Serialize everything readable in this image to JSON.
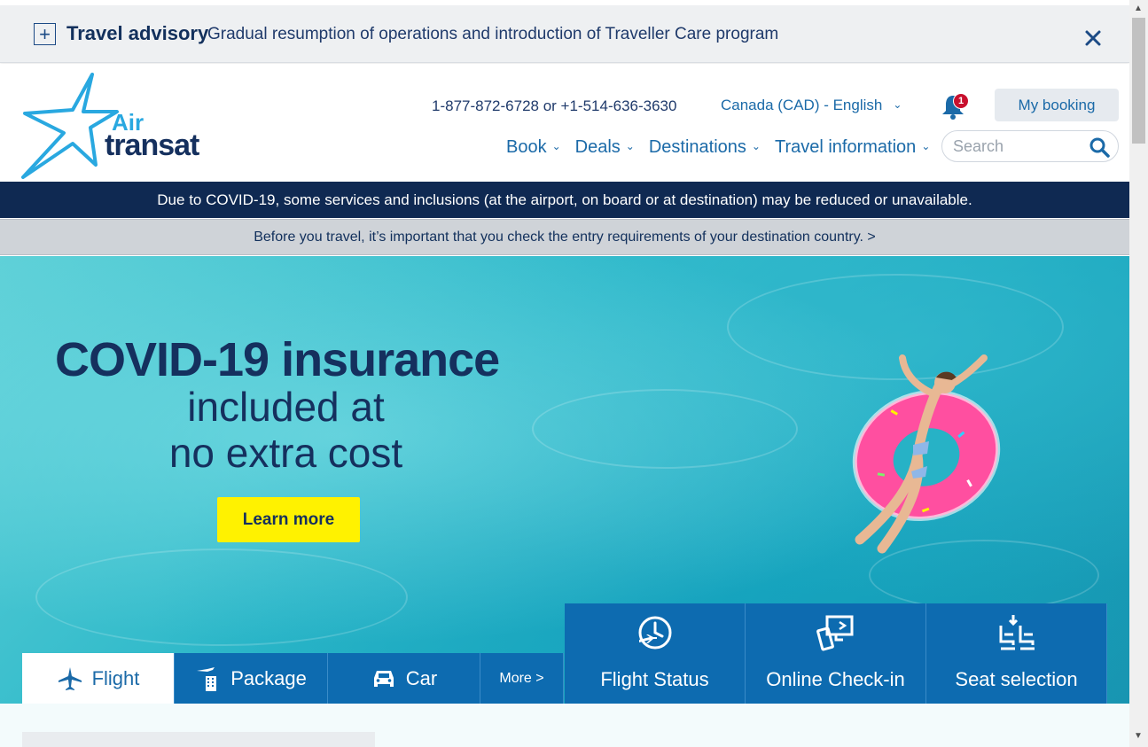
{
  "advisory": {
    "title": "Travel advisory",
    "text": "Gradual resumption of operations and introduction of Traveller Care program"
  },
  "brand": {
    "line1": "Air",
    "line2": "transat"
  },
  "header": {
    "phone": "1-877-872-6728 or +1-514-636-3630",
    "locale": "Canada (CAD) - English",
    "notifications_count": "1",
    "my_booking": "My booking"
  },
  "nav": {
    "items": [
      {
        "label": "Book"
      },
      {
        "label": "Deals"
      },
      {
        "label": "Destinations"
      },
      {
        "label": "Travel information"
      }
    ]
  },
  "search": {
    "placeholder": "Search"
  },
  "banners": {
    "covid": "Due to COVID-19, some services and inclusions (at the airport, on board or at destination) may be reduced or unavailable.",
    "entry": "Before you travel, it’s important that you check the entry requirements of your destination country. >"
  },
  "hero": {
    "headline": "COVID-19 insurance",
    "line2": "included at",
    "line3": "no extra cost",
    "cta": "Learn more"
  },
  "tabs": [
    {
      "label": "Flight",
      "icon": "plane-icon"
    },
    {
      "label": "Package",
      "icon": "hotel-icon"
    },
    {
      "label": "Car",
      "icon": "car-icon"
    },
    {
      "label": "More >",
      "icon": ""
    }
  ],
  "quick_links": [
    {
      "label": "Flight Status",
      "icon": "clock-plane-icon"
    },
    {
      "label": "Online Check-in",
      "icon": "checkin-icon"
    },
    {
      "label": "Seat selection",
      "icon": "seat-icon"
    }
  ],
  "colors": {
    "navy": "#0f2952",
    "brand_blue": "#0d6bb0",
    "link_blue": "#1b6aa8",
    "cta_yellow": "#fff200",
    "logo_cyan": "#29a8e0"
  }
}
